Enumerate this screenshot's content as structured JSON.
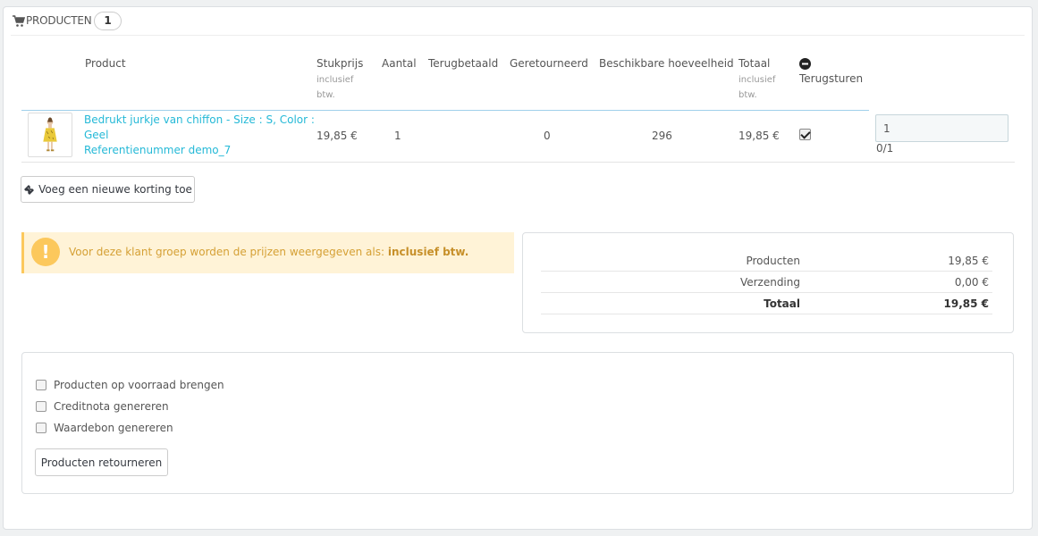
{
  "panel": {
    "title": "Producten",
    "count": "1"
  },
  "table": {
    "headers": {
      "product": "Product",
      "unit_price": "Stukprijs",
      "unit_price_sub1": "inclusief",
      "unit_price_sub2": "btw.",
      "quantity": "Aantal",
      "refunded": "Terugbetaald",
      "returned": "Geretourneerd",
      "available": "Beschikbare hoeveelheid",
      "total": "Totaal",
      "total_sub1": "inclusief",
      "total_sub2": "btw.",
      "return": "Terugsturen"
    },
    "rows": [
      {
        "name_line1": "Bedrukt jurkje van chiffon - Size : S, Color :",
        "name_line2": "Geel",
        "reference": "Referentienummer demo_7",
        "unit_price": "19,85 €",
        "quantity": "1",
        "refunded": "",
        "returned": "0",
        "available": "296",
        "total": "19,85 €",
        "return_checked": true,
        "return_qty": "1",
        "return_qty_info": "0/1"
      }
    ]
  },
  "discount_button": "Voeg een nieuwe korting toe",
  "alert": {
    "text": "Voor deze klant groep worden de prijzen weergegeven als:",
    "strong": "inclusief btw."
  },
  "summary": {
    "rows": [
      {
        "label": "Producten",
        "value": "19,85 €"
      },
      {
        "label": "Verzending",
        "value": "0,00 €"
      },
      {
        "label": "Totaal",
        "value": "19,85 €"
      }
    ]
  },
  "options": {
    "items": [
      {
        "label": "Producten op voorraad brengen",
        "checked": false
      },
      {
        "label": "Creditnota genereren",
        "checked": false
      },
      {
        "label": "Waardebon genereren",
        "checked": false
      }
    ],
    "submit": "Producten retourneren"
  },
  "colors": {
    "link": "#25b9d7",
    "alert_bg": "#fff3d7",
    "alert_accent": "#fcc85c"
  }
}
